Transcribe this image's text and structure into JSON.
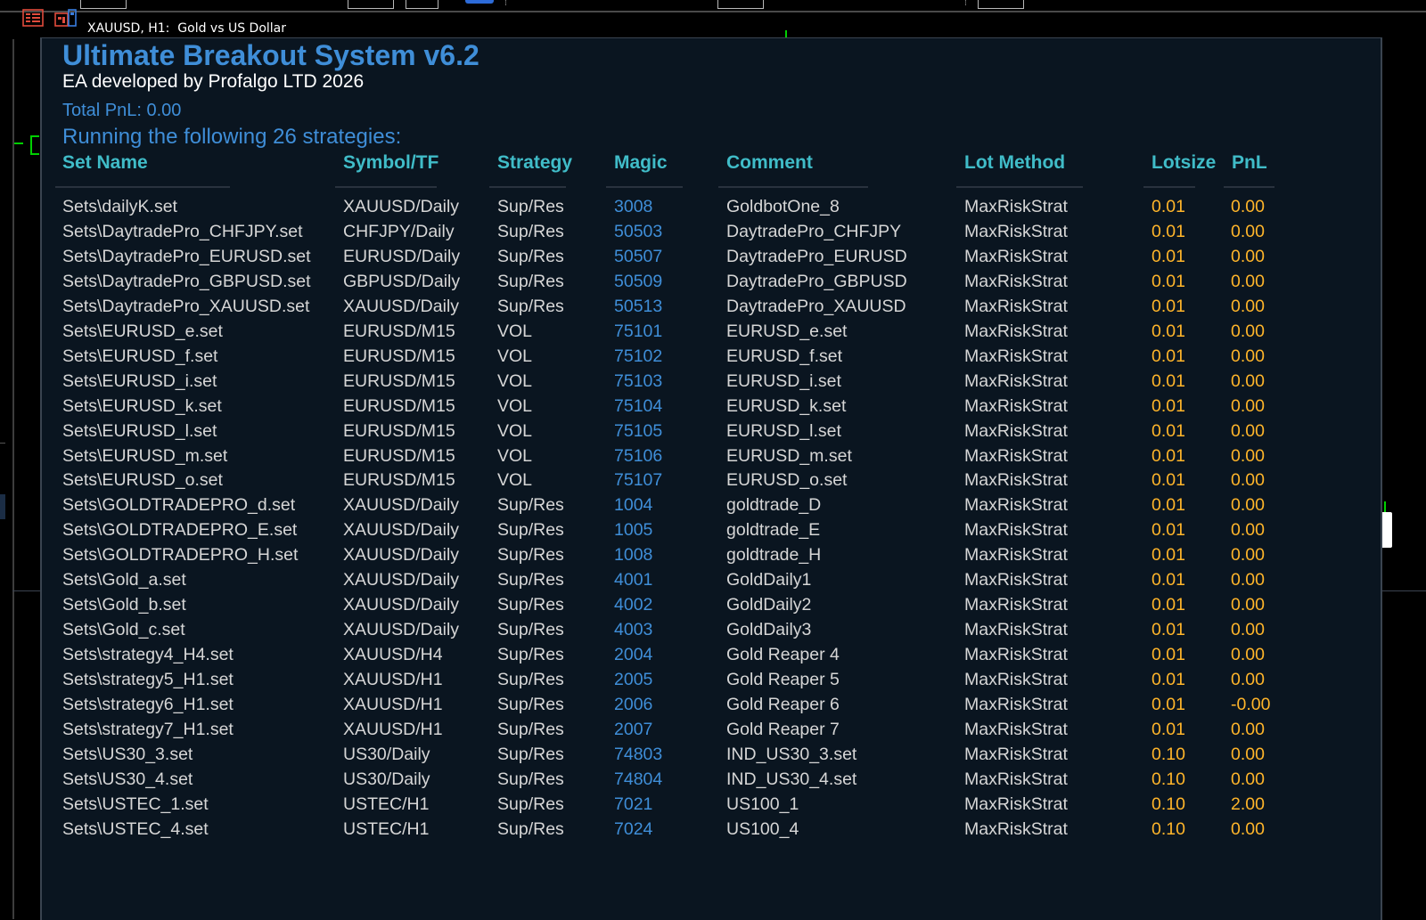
{
  "window": {
    "title": "XAUUSD, H1:  Gold vs US Dollar"
  },
  "panel": {
    "heading": "Ultimate Breakout System v6.2",
    "subtitle": "EA developed by Profalgo LTD 2026",
    "total_pnl": "Total PnL: 0.00",
    "running": "Running the following 26 strategies:"
  },
  "columns": [
    "Set Name",
    "Symbol/TF",
    "Strategy",
    "Magic",
    "Comment",
    "Lot Method",
    "Lotsize",
    "PnL"
  ],
  "rows": [
    [
      "Sets\\dailyK.set",
      "XAUUSD/Daily",
      "Sup/Res",
      "3008",
      "GoldbotOne_8",
      "MaxRiskStrat",
      "0.01",
      "0.00"
    ],
    [
      "Sets\\DaytradePro_CHFJPY.set",
      "CHFJPY/Daily",
      "Sup/Res",
      "50503",
      "DaytradePro_CHFJPY",
      "MaxRiskStrat",
      "0.01",
      "0.00"
    ],
    [
      "Sets\\DaytradePro_EURUSD.set",
      "EURUSD/Daily",
      "Sup/Res",
      "50507",
      "DaytradePro_EURUSD",
      "MaxRiskStrat",
      "0.01",
      "0.00"
    ],
    [
      "Sets\\DaytradePro_GBPUSD.set",
      "GBPUSD/Daily",
      "Sup/Res",
      "50509",
      "DaytradePro_GBPUSD",
      "MaxRiskStrat",
      "0.01",
      "0.00"
    ],
    [
      "Sets\\DaytradePro_XAUUSD.set",
      "XAUUSD/Daily",
      "Sup/Res",
      "50513",
      "DaytradePro_XAUUSD",
      "MaxRiskStrat",
      "0.01",
      "0.00"
    ],
    [
      "Sets\\EURUSD_e.set",
      "EURUSD/M15",
      "VOL",
      "75101",
      "EURUSD_e.set",
      "MaxRiskStrat",
      "0.01",
      "0.00"
    ],
    [
      "Sets\\EURUSD_f.set",
      "EURUSD/M15",
      "VOL",
      "75102",
      "EURUSD_f.set",
      "MaxRiskStrat",
      "0.01",
      "0.00"
    ],
    [
      "Sets\\EURUSD_i.set",
      "EURUSD/M15",
      "VOL",
      "75103",
      "EURUSD_i.set",
      "MaxRiskStrat",
      "0.01",
      "0.00"
    ],
    [
      "Sets\\EURUSD_k.set",
      "EURUSD/M15",
      "VOL",
      "75104",
      "EURUSD_k.set",
      "MaxRiskStrat",
      "0.01",
      "0.00"
    ],
    [
      "Sets\\EURUSD_l.set",
      "EURUSD/M15",
      "VOL",
      "75105",
      "EURUSD_l.set",
      "MaxRiskStrat",
      "0.01",
      "0.00"
    ],
    [
      "Sets\\EURUSD_m.set",
      "EURUSD/M15",
      "VOL",
      "75106",
      "EURUSD_m.set",
      "MaxRiskStrat",
      "0.01",
      "0.00"
    ],
    [
      "Sets\\EURUSD_o.set",
      "EURUSD/M15",
      "VOL",
      "75107",
      "EURUSD_o.set",
      "MaxRiskStrat",
      "0.01",
      "0.00"
    ],
    [
      "Sets\\GOLDTRADEPRO_d.set",
      "XAUUSD/Daily",
      "Sup/Res",
      "1004",
      "goldtrade_D",
      "MaxRiskStrat",
      "0.01",
      "0.00"
    ],
    [
      "Sets\\GOLDTRADEPRO_E.set",
      "XAUUSD/Daily",
      "Sup/Res",
      "1005",
      "goldtrade_E",
      "MaxRiskStrat",
      "0.01",
      "0.00"
    ],
    [
      "Sets\\GOLDTRADEPRO_H.set",
      "XAUUSD/Daily",
      "Sup/Res",
      "1008",
      "goldtrade_H",
      "MaxRiskStrat",
      "0.01",
      "0.00"
    ],
    [
      "Sets\\Gold_a.set",
      "XAUUSD/Daily",
      "Sup/Res",
      "4001",
      "GoldDaily1",
      "MaxRiskStrat",
      "0.01",
      "0.00"
    ],
    [
      "Sets\\Gold_b.set",
      "XAUUSD/Daily",
      "Sup/Res",
      "4002",
      "GoldDaily2",
      "MaxRiskStrat",
      "0.01",
      "0.00"
    ],
    [
      "Sets\\Gold_c.set",
      "XAUUSD/Daily",
      "Sup/Res",
      "4003",
      "GoldDaily3",
      "MaxRiskStrat",
      "0.01",
      "0.00"
    ],
    [
      "Sets\\strategy4_H4.set",
      "XAUUSD/H4",
      "Sup/Res",
      "2004",
      "Gold Reaper 4",
      "MaxRiskStrat",
      "0.01",
      "0.00"
    ],
    [
      "Sets\\strategy5_H1.set",
      "XAUUSD/H1",
      "Sup/Res",
      "2005",
      "Gold Reaper 5",
      "MaxRiskStrat",
      "0.01",
      "0.00"
    ],
    [
      "Sets\\strategy6_H1.set",
      "XAUUSD/H1",
      "Sup/Res",
      "2006",
      "Gold Reaper 6",
      "MaxRiskStrat",
      "0.01",
      "-0.00"
    ],
    [
      "Sets\\strategy7_H1.set",
      "XAUUSD/H1",
      "Sup/Res",
      "2007",
      "Gold Reaper 7",
      "MaxRiskStrat",
      "0.01",
      "0.00"
    ],
    [
      "Sets\\US30_3.set",
      "US30/Daily",
      "Sup/Res",
      "74803",
      "IND_US30_3.set",
      "MaxRiskStrat",
      "0.10",
      "0.00"
    ],
    [
      "Sets\\US30_4.set",
      "US30/Daily",
      "Sup/Res",
      "74804",
      "IND_US30_4.set",
      "MaxRiskStrat",
      "0.10",
      "0.00"
    ],
    [
      "Sets\\USTEC_1.set",
      "USTEC/H1",
      "Sup/Res",
      "7021",
      "US100_1",
      "MaxRiskStrat",
      "0.10",
      "2.00"
    ],
    [
      "Sets\\USTEC_4.set",
      "USTEC/H1",
      "Sup/Res",
      "7024",
      "US100_4",
      "MaxRiskStrat",
      "0.10",
      "0.00"
    ]
  ]
}
